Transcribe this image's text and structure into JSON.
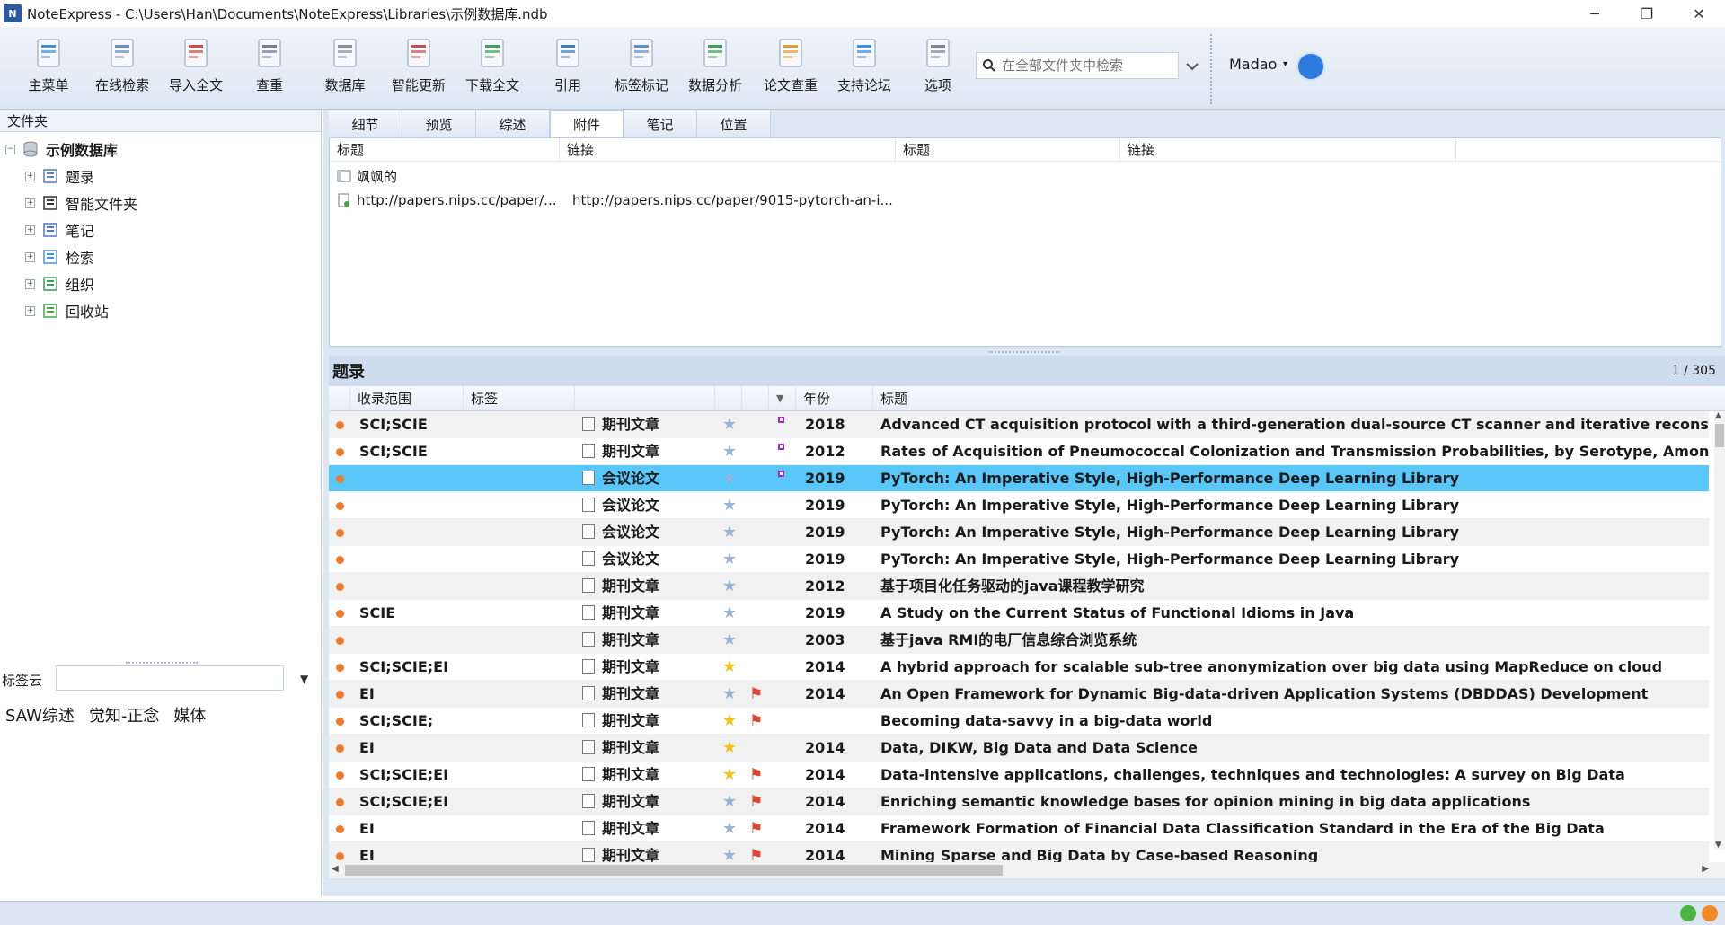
{
  "window": {
    "title": "NoteExpress - C:\\Users\\Han\\Documents\\NoteExpress\\Libraries\\示例数据库.ndb",
    "app_icon_text": "N",
    "controls": [
      "─",
      "❐",
      "✕"
    ]
  },
  "toolbar": {
    "buttons": [
      {
        "label": "主菜单",
        "icon": "main-menu-icon"
      },
      {
        "label": "在线检索",
        "icon": "online-search-icon"
      },
      {
        "label": "导入全文",
        "icon": "import-fulltext-icon"
      },
      {
        "label": "查重",
        "icon": "dedupe-icon"
      },
      {
        "label": "数据库",
        "icon": "database-icon"
      },
      {
        "label": "智能更新",
        "icon": "smart-update-icon"
      },
      {
        "label": "下载全文",
        "icon": "download-fulltext-icon"
      },
      {
        "label": "引用",
        "icon": "cite-icon"
      },
      {
        "label": "标签标记",
        "icon": "tag-icon"
      },
      {
        "label": "数据分析",
        "icon": "data-analysis-icon"
      },
      {
        "label": "论文查重",
        "icon": "paper-check-icon"
      },
      {
        "label": "支持论坛",
        "icon": "forum-icon"
      },
      {
        "label": "选项",
        "icon": "options-icon"
      }
    ],
    "search_placeholder": "在全部文件夹中检索",
    "user_name": "Madao",
    "user_caret": "▾"
  },
  "folders": {
    "header": "文件夹",
    "root": "示例数据库",
    "items": [
      {
        "label": "题录",
        "icon": "list-icon"
      },
      {
        "label": "智能文件夹",
        "icon": "smart-folder-icon"
      },
      {
        "label": "笔记",
        "icon": "notes-icon"
      },
      {
        "label": "检索",
        "icon": "search-icon"
      },
      {
        "label": "组织",
        "icon": "organize-icon"
      },
      {
        "label": "回收站",
        "icon": "recycle-bin-icon"
      }
    ],
    "expander": "+",
    "collapser": "−"
  },
  "tagcloud": {
    "label": "标签云",
    "tags": [
      "SAW综述",
      "觉知-正念",
      "媒体"
    ]
  },
  "detail_tabs": {
    "tabs": [
      "细节",
      "预览",
      "综述",
      "附件",
      "笔记",
      "位置"
    ],
    "active": "附件"
  },
  "attachments": {
    "columns": [
      "标题",
      "链接",
      "标题",
      "链接"
    ],
    "rows": [
      {
        "title": "飒飒的",
        "link": ""
      },
      {
        "title": "http://papers.nips.cc/paper/...",
        "link": "http://papers.nips.cc/paper/9015-pytorch-an-i..."
      }
    ]
  },
  "references": {
    "title": "题录",
    "count": "1 / 305",
    "columns": {
      "scope": "收录范围",
      "tags": "标签",
      "year": "年份",
      "title": "标题"
    },
    "rows": [
      {
        "scope": "SCI;SCIE",
        "type": "期刊文章",
        "star": false,
        "flag": false,
        "mark": true,
        "year": "2018",
        "title": "Advanced CT acquisition protocol with a third-generation dual-source CT scanner and iterative reconstruction"
      },
      {
        "scope": "SCI;SCIE",
        "type": "期刊文章",
        "star": false,
        "flag": false,
        "mark": true,
        "year": "2012",
        "title": "Rates of Acquisition of Pneumococcal Colonization and Transmission Probabilities, by Serotype, Among Newborn"
      },
      {
        "scope": "",
        "type": "会议论文",
        "star": false,
        "flag": false,
        "mark": true,
        "year": "2019",
        "title": "PyTorch: An Imperative Style, High-Performance Deep Learning Library",
        "selected": true
      },
      {
        "scope": "",
        "type": "会议论文",
        "star": false,
        "flag": false,
        "mark": false,
        "year": "2019",
        "title": "PyTorch: An Imperative Style, High-Performance Deep Learning Library"
      },
      {
        "scope": "",
        "type": "会议论文",
        "star": false,
        "flag": false,
        "mark": false,
        "year": "2019",
        "title": "PyTorch: An Imperative Style, High-Performance Deep Learning Library"
      },
      {
        "scope": "",
        "type": "会议论文",
        "star": false,
        "flag": false,
        "mark": false,
        "year": "2019",
        "title": "PyTorch: An Imperative Style, High-Performance Deep Learning Library"
      },
      {
        "scope": "",
        "type": "期刊文章",
        "star": false,
        "flag": false,
        "mark": false,
        "year": "2012",
        "title": "基于项目化任务驱动的java课程教学研究"
      },
      {
        "scope": "SCIE",
        "type": "期刊文章",
        "star": false,
        "flag": false,
        "mark": false,
        "year": "2019",
        "title": "A Study on the Current Status of Functional Idioms in Java"
      },
      {
        "scope": "",
        "type": "期刊文章",
        "star": false,
        "flag": false,
        "mark": false,
        "year": "2003",
        "title": "基于java RMI的电厂信息综合浏览系统"
      },
      {
        "scope": "SCI;SCIE;EI",
        "type": "期刊文章",
        "star": true,
        "flag": false,
        "mark": false,
        "year": "2014",
        "title": "A hybrid approach for scalable sub-tree anonymization over big data using MapReduce on cloud"
      },
      {
        "scope": "EI",
        "type": "期刊文章",
        "star": false,
        "flag": true,
        "mark": false,
        "year": "2014",
        "title": "An Open Framework for Dynamic Big-data-driven Application Systems (DBDDAS) Development"
      },
      {
        "scope": "SCI;SCIE;",
        "type": "期刊文章",
        "star": true,
        "flag": true,
        "mark": false,
        "year": "",
        "title": "Becoming data-savvy in a big-data world"
      },
      {
        "scope": "EI",
        "type": "期刊文章",
        "star": true,
        "flag": false,
        "mark": false,
        "year": "2014",
        "title": "Data, DIKW, Big Data and Data Science"
      },
      {
        "scope": "SCI;SCIE;EI",
        "type": "期刊文章",
        "star": true,
        "flag": true,
        "mark": false,
        "year": "2014",
        "title": "Data-intensive applications, challenges, techniques and technologies: A survey on Big Data"
      },
      {
        "scope": "SCI;SCIE;EI",
        "type": "期刊文章",
        "star": false,
        "flag": true,
        "mark": false,
        "year": "2014",
        "title": "Enriching semantic knowledge bases for opinion mining in big data applications"
      },
      {
        "scope": "EI",
        "type": "期刊文章",
        "star": false,
        "flag": true,
        "mark": false,
        "year": "2014",
        "title": "Framework Formation of Financial Data Classification Standard in the Era of the Big Data"
      },
      {
        "scope": "EI",
        "type": "期刊文章",
        "star": false,
        "flag": true,
        "mark": false,
        "year": "2014",
        "title": "Mining Sparse and Big Data by Case-based Reasoning"
      }
    ],
    "star_glyph": "★",
    "flag_glyph": "⚑",
    "sort_glyph": "▼"
  },
  "scroll": {
    "up": "▲",
    "down": "▼",
    "left": "◀",
    "right": "▶"
  },
  "colors": {
    "selected_row": "#59c7f9",
    "dot": "#f07b2a",
    "star_on": "#f5c116",
    "flag": "#e04532"
  }
}
